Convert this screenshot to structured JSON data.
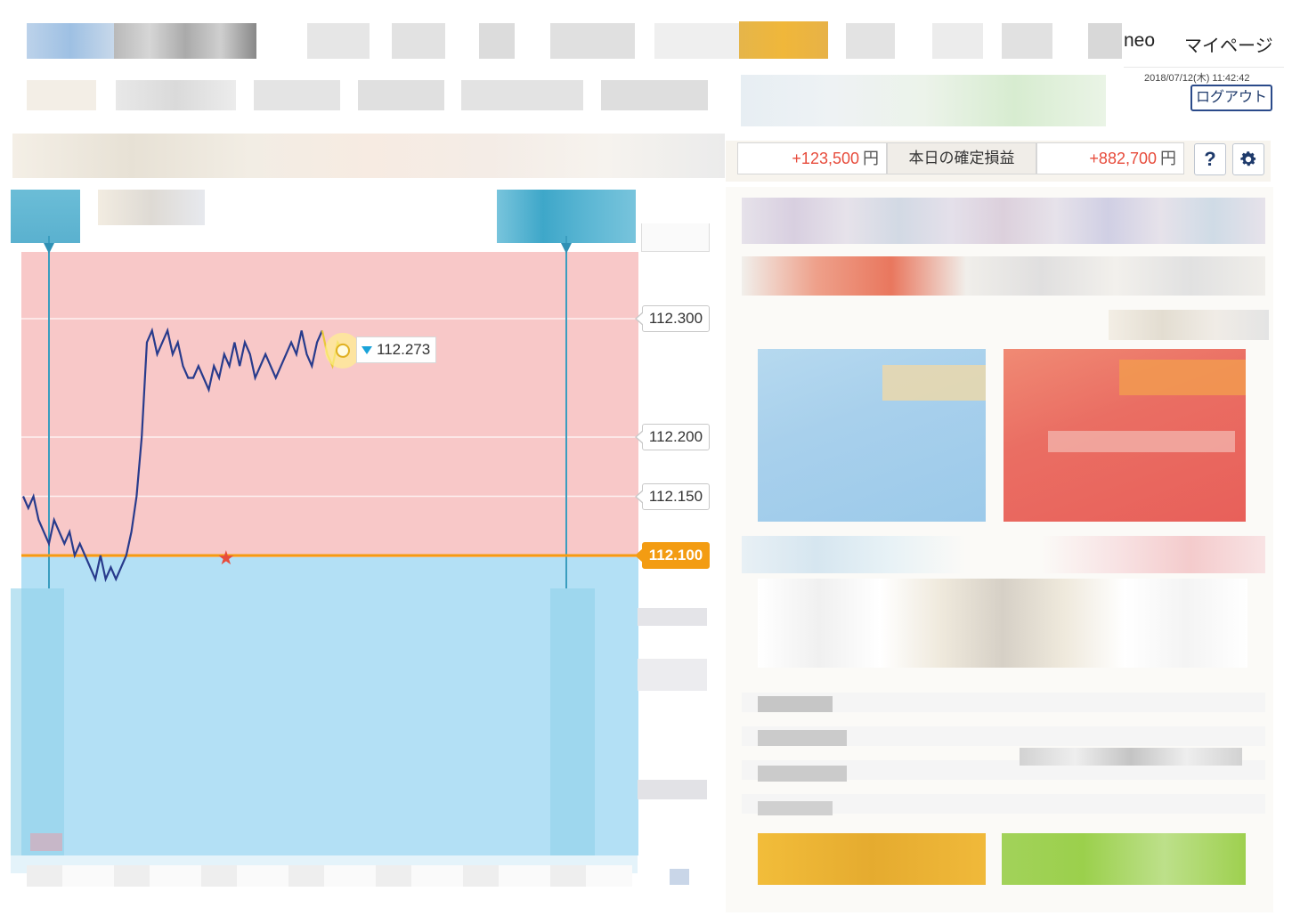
{
  "header": {
    "brand_suffix": "neo",
    "mypage_label": "マイページ",
    "datetime": "2018/07/12(木) 11:42:42",
    "logout_label": "ログアウト"
  },
  "summary": {
    "valuation_pl": "+123,500",
    "yen1": "円",
    "today_realized_label": "本日の確定損益",
    "today_realized_pl": "+882,700",
    "yen2": "円",
    "help_label": "?"
  },
  "chart": {
    "current_price_marker": "112.273",
    "ticks": [
      "112.300",
      "112.200",
      "112.150",
      "112.100"
    ],
    "current_tick": "112.100",
    "colors": {
      "upper_zone": "#f8c8c8",
      "lower_zone": "#b3e0f5",
      "line": "#283b8c",
      "current_line": "#f39c12",
      "marker": "#1aa3d9"
    }
  },
  "chart_data": {
    "type": "line",
    "title": "",
    "xlabel": "",
    "ylabel": "",
    "ylim": [
      112.0,
      112.36
    ],
    "strike": 112.1,
    "series": [
      {
        "values": [
          112.15,
          112.14,
          112.15,
          112.13,
          112.12,
          112.11,
          112.13,
          112.12,
          112.11,
          112.12,
          112.1,
          112.11,
          112.1,
          112.09,
          112.08,
          112.1,
          112.08,
          112.09,
          112.08,
          112.09,
          112.1,
          112.12,
          112.15,
          112.2,
          112.28,
          112.29,
          112.27,
          112.28,
          112.29,
          112.27,
          112.28,
          112.26,
          112.25,
          112.25,
          112.26,
          112.25,
          112.24,
          112.26,
          112.25,
          112.27,
          112.26,
          112.28,
          112.26,
          112.28,
          112.27,
          112.25,
          112.26,
          112.27,
          112.26,
          112.25,
          112.26,
          112.27,
          112.28,
          112.27,
          112.29,
          112.27,
          112.26,
          112.28,
          112.29,
          112.27,
          112.26,
          112.28,
          112.273
        ]
      }
    ]
  }
}
